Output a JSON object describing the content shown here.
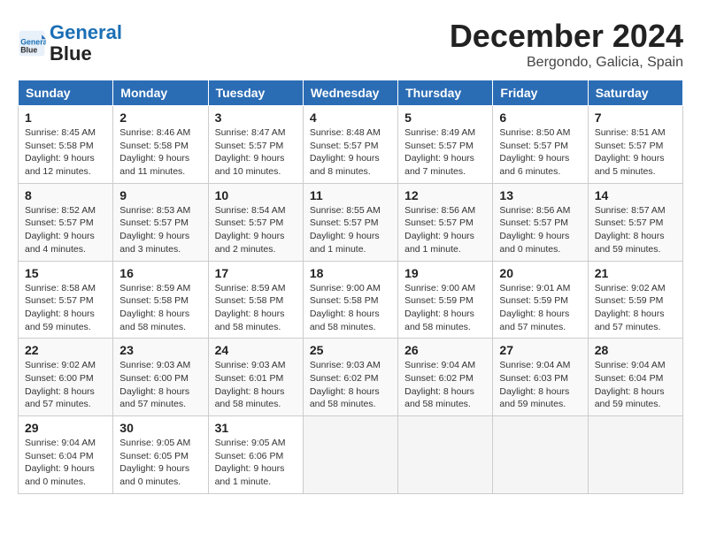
{
  "header": {
    "logo_line1": "General",
    "logo_line2": "Blue",
    "month_year": "December 2024",
    "location": "Bergondo, Galicia, Spain"
  },
  "weekdays": [
    "Sunday",
    "Monday",
    "Tuesday",
    "Wednesday",
    "Thursday",
    "Friday",
    "Saturday"
  ],
  "weeks": [
    [
      {
        "day": "1",
        "info": "Sunrise: 8:45 AM\nSunset: 5:58 PM\nDaylight: 9 hours\nand 12 minutes."
      },
      {
        "day": "2",
        "info": "Sunrise: 8:46 AM\nSunset: 5:58 PM\nDaylight: 9 hours\nand 11 minutes."
      },
      {
        "day": "3",
        "info": "Sunrise: 8:47 AM\nSunset: 5:57 PM\nDaylight: 9 hours\nand 10 minutes."
      },
      {
        "day": "4",
        "info": "Sunrise: 8:48 AM\nSunset: 5:57 PM\nDaylight: 9 hours\nand 8 minutes."
      },
      {
        "day": "5",
        "info": "Sunrise: 8:49 AM\nSunset: 5:57 PM\nDaylight: 9 hours\nand 7 minutes."
      },
      {
        "day": "6",
        "info": "Sunrise: 8:50 AM\nSunset: 5:57 PM\nDaylight: 9 hours\nand 6 minutes."
      },
      {
        "day": "7",
        "info": "Sunrise: 8:51 AM\nSunset: 5:57 PM\nDaylight: 9 hours\nand 5 minutes."
      }
    ],
    [
      {
        "day": "8",
        "info": "Sunrise: 8:52 AM\nSunset: 5:57 PM\nDaylight: 9 hours\nand 4 minutes."
      },
      {
        "day": "9",
        "info": "Sunrise: 8:53 AM\nSunset: 5:57 PM\nDaylight: 9 hours\nand 3 minutes."
      },
      {
        "day": "10",
        "info": "Sunrise: 8:54 AM\nSunset: 5:57 PM\nDaylight: 9 hours\nand 2 minutes."
      },
      {
        "day": "11",
        "info": "Sunrise: 8:55 AM\nSunset: 5:57 PM\nDaylight: 9 hours\nand 1 minute."
      },
      {
        "day": "12",
        "info": "Sunrise: 8:56 AM\nSunset: 5:57 PM\nDaylight: 9 hours\nand 1 minute."
      },
      {
        "day": "13",
        "info": "Sunrise: 8:56 AM\nSunset: 5:57 PM\nDaylight: 9 hours\nand 0 minutes."
      },
      {
        "day": "14",
        "info": "Sunrise: 8:57 AM\nSunset: 5:57 PM\nDaylight: 8 hours\nand 59 minutes."
      }
    ],
    [
      {
        "day": "15",
        "info": "Sunrise: 8:58 AM\nSunset: 5:57 PM\nDaylight: 8 hours\nand 59 minutes."
      },
      {
        "day": "16",
        "info": "Sunrise: 8:59 AM\nSunset: 5:58 PM\nDaylight: 8 hours\nand 58 minutes."
      },
      {
        "day": "17",
        "info": "Sunrise: 8:59 AM\nSunset: 5:58 PM\nDaylight: 8 hours\nand 58 minutes."
      },
      {
        "day": "18",
        "info": "Sunrise: 9:00 AM\nSunset: 5:58 PM\nDaylight: 8 hours\nand 58 minutes."
      },
      {
        "day": "19",
        "info": "Sunrise: 9:00 AM\nSunset: 5:59 PM\nDaylight: 8 hours\nand 58 minutes."
      },
      {
        "day": "20",
        "info": "Sunrise: 9:01 AM\nSunset: 5:59 PM\nDaylight: 8 hours\nand 57 minutes."
      },
      {
        "day": "21",
        "info": "Sunrise: 9:02 AM\nSunset: 5:59 PM\nDaylight: 8 hours\nand 57 minutes."
      }
    ],
    [
      {
        "day": "22",
        "info": "Sunrise: 9:02 AM\nSunset: 6:00 PM\nDaylight: 8 hours\nand 57 minutes."
      },
      {
        "day": "23",
        "info": "Sunrise: 9:03 AM\nSunset: 6:00 PM\nDaylight: 8 hours\nand 57 minutes."
      },
      {
        "day": "24",
        "info": "Sunrise: 9:03 AM\nSunset: 6:01 PM\nDaylight: 8 hours\nand 58 minutes."
      },
      {
        "day": "25",
        "info": "Sunrise: 9:03 AM\nSunset: 6:02 PM\nDaylight: 8 hours\nand 58 minutes."
      },
      {
        "day": "26",
        "info": "Sunrise: 9:04 AM\nSunset: 6:02 PM\nDaylight: 8 hours\nand 58 minutes."
      },
      {
        "day": "27",
        "info": "Sunrise: 9:04 AM\nSunset: 6:03 PM\nDaylight: 8 hours\nand 59 minutes."
      },
      {
        "day": "28",
        "info": "Sunrise: 9:04 AM\nSunset: 6:04 PM\nDaylight: 8 hours\nand 59 minutes."
      }
    ],
    [
      {
        "day": "29",
        "info": "Sunrise: 9:04 AM\nSunset: 6:04 PM\nDaylight: 9 hours\nand 0 minutes."
      },
      {
        "day": "30",
        "info": "Sunrise: 9:05 AM\nSunset: 6:05 PM\nDaylight: 9 hours\nand 0 minutes."
      },
      {
        "day": "31",
        "info": "Sunrise: 9:05 AM\nSunset: 6:06 PM\nDaylight: 9 hours\nand 1 minute."
      },
      null,
      null,
      null,
      null
    ]
  ]
}
